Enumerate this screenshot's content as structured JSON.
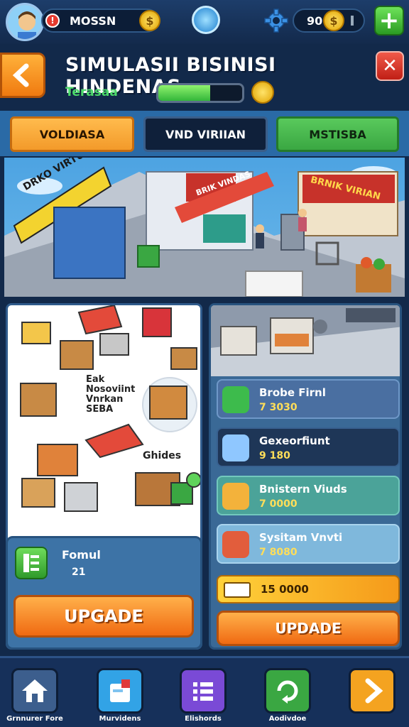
{
  "topbar": {
    "player_name": "MOSSN",
    "alert": "!",
    "currency_amount": "90",
    "coin_symbol": "$",
    "add": "+"
  },
  "header": {
    "title": "SIMULASII BISINISI HINDENAS",
    "subtitle": "Terasaa",
    "progress": 0.62,
    "back": "‹",
    "close": "✕"
  },
  "tabs": [
    {
      "label": "VOLDIASA",
      "color": "#f39a2a"
    },
    {
      "label": "VND VIRIIAN",
      "color": "#0f203a"
    },
    {
      "label": "MSTISBA",
      "color": "#3aa742"
    }
  ],
  "scene": {
    "sign_left": "DRKO VIRTUIA",
    "sign_center": "BRIK VINDAS",
    "sign_right": "BRNIK VIRIAN"
  },
  "left_panel": {
    "items_text": "Eak\nNosoviint\nVnrkan\nSEBA",
    "badge": "Ghides",
    "card_title": "Fomul",
    "card_value": "21",
    "upgrade": "UPGADE"
  },
  "right_panel": {
    "cards": [
      {
        "name": "Brobe Firnl",
        "value": "7 3030",
        "color": "#4a6fa1",
        "border": "#6f98c8",
        "icon": "#3dbb4c"
      },
      {
        "name": "Gexeorfiunt",
        "value": "9 180",
        "color": "#1e3657",
        "border": "#38608f",
        "icon": "#8fc7ff"
      },
      {
        "name": "Bnistern Viuds",
        "value": "7 0000",
        "color": "#4ba399",
        "border": "#72c8bd",
        "icon": "#f3b23b"
      },
      {
        "name": "Sysitam Vnvti",
        "value": "7 8080",
        "color": "#7fb8dc",
        "border": "#a9d4ee",
        "icon": "#e25d3c"
      }
    ],
    "total": "15 0000",
    "upgrade": "UPDADE"
  },
  "bottom_nav": [
    {
      "label": "Grnnurer Fore",
      "color": "#3c5e8d",
      "icon": "house-icon"
    },
    {
      "label": "Murvidens",
      "color": "#32a3e6",
      "icon": "document-icon"
    },
    {
      "label": "Elishords",
      "color": "#7a4ad6",
      "icon": "list-icon"
    },
    {
      "label": "Aodivdoe",
      "color": "#3aa742",
      "icon": "refresh-icon"
    },
    {
      "label": "",
      "color": "#f4a320",
      "icon": "next-arrow-icon"
    }
  ]
}
